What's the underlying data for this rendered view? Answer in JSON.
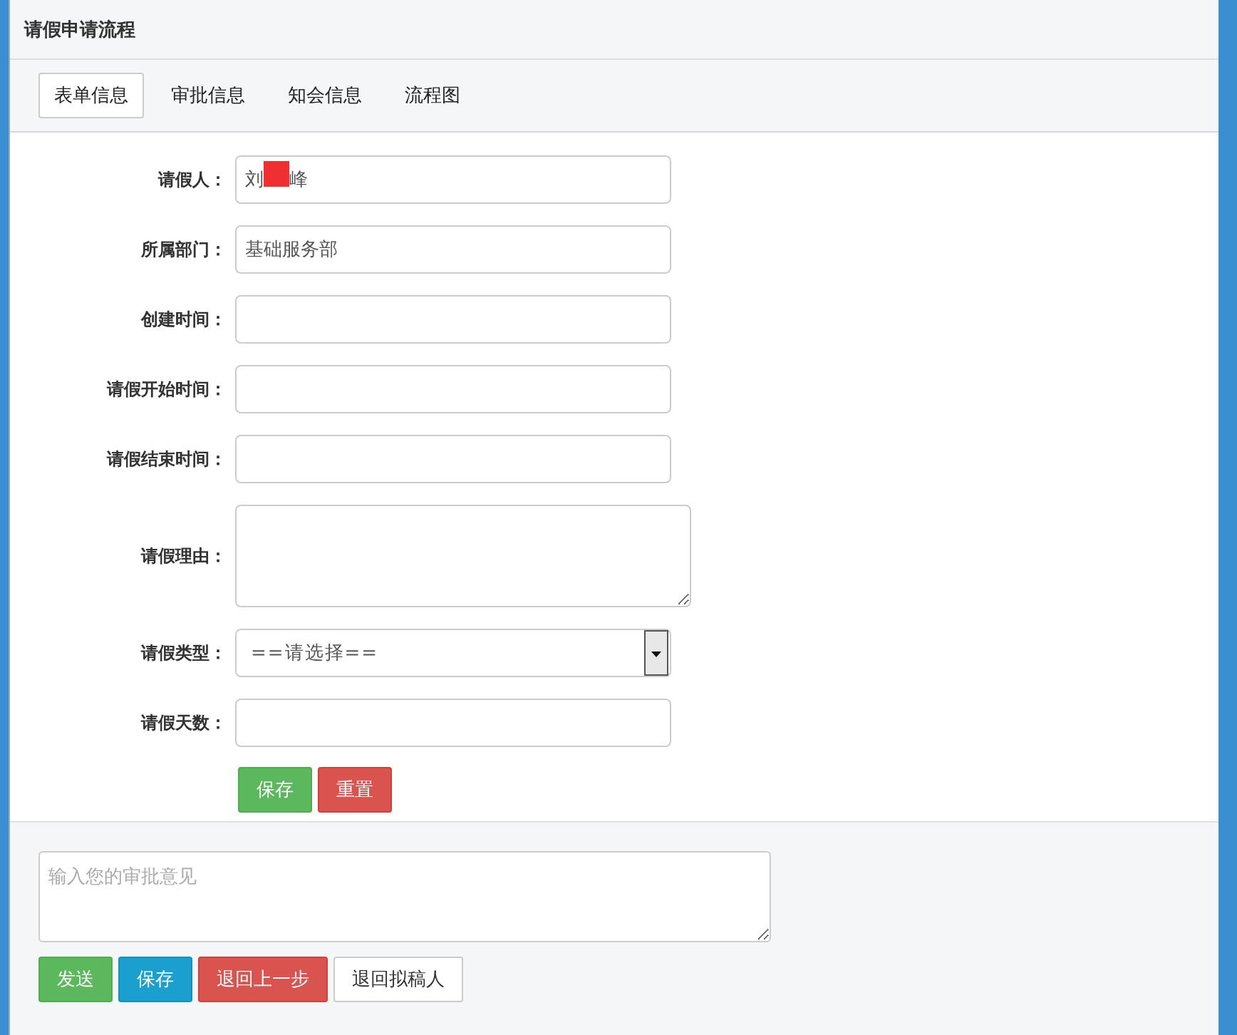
{
  "window": {
    "title": "请假申请流程"
  },
  "tabs": [
    {
      "label": "表单信息",
      "selected": true
    },
    {
      "label": "审批信息",
      "selected": false
    },
    {
      "label": "知会信息",
      "selected": false
    },
    {
      "label": "流程图",
      "selected": false
    }
  ],
  "form": {
    "fields": [
      {
        "kind": "redacted",
        "label": "请假人：",
        "value_before": "刘",
        "value_after": "峰"
      },
      {
        "kind": "text",
        "label": "所属部门：",
        "value": "基础服务部"
      },
      {
        "kind": "text",
        "label": "创建时间："
      },
      {
        "kind": "text",
        "label": "请假开始时间："
      },
      {
        "kind": "text",
        "label": "请假结束时间："
      },
      {
        "kind": "textarea",
        "label": "请假理由："
      },
      {
        "kind": "select",
        "label": "请假类型：",
        "value": "==请选择=="
      },
      {
        "kind": "text",
        "label": "请假天数："
      }
    ],
    "buttons": [
      {
        "label": "保存",
        "kind": "success"
      },
      {
        "label": "重置",
        "kind": "danger"
      }
    ]
  },
  "approval": {
    "placeholder": "输入您的审批意见",
    "buttons": [
      {
        "label": "发送",
        "kind": "success"
      },
      {
        "label": "保存",
        "kind": "info"
      },
      {
        "label": "退回上一步",
        "kind": "danger"
      },
      {
        "label": "退回拟稿人",
        "kind": "default"
      }
    ]
  }
}
